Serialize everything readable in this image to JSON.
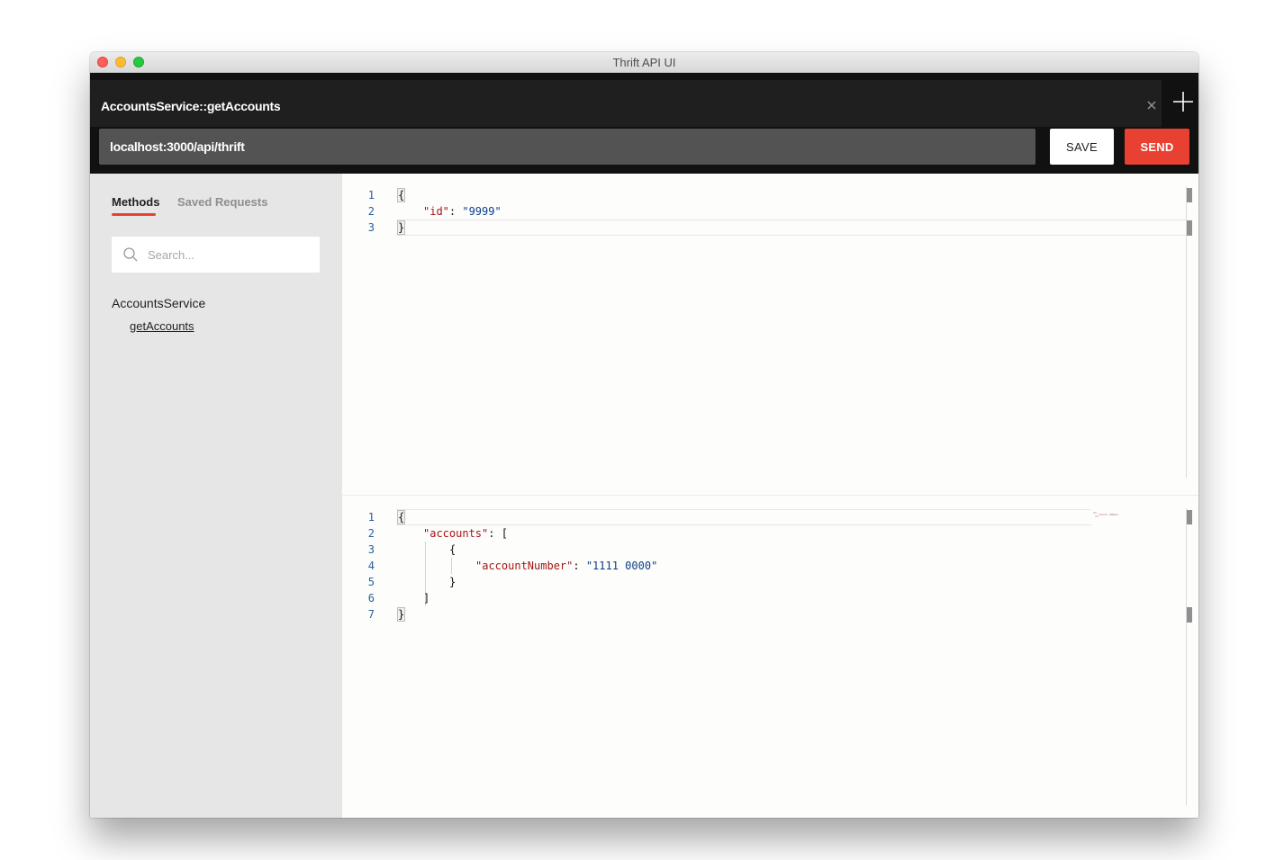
{
  "window": {
    "title": "Thrift API UI"
  },
  "tab": {
    "label": "AccountsService::getAccounts"
  },
  "request": {
    "url": "localhost:3000/api/thrift",
    "save_label": "SAVE",
    "send_label": "SEND"
  },
  "sidebar": {
    "tabs": [
      {
        "label": "Methods"
      },
      {
        "label": "Saved Requests"
      }
    ],
    "search_placeholder": "Search...",
    "service": "AccountsService",
    "methods": [
      "getAccounts"
    ]
  },
  "request_editor": {
    "line_numbers": [
      "1",
      "2",
      "3"
    ],
    "lines": {
      "l1": "{",
      "l2_key": "\"id\"",
      "l2_sep": ": ",
      "l2_val": "\"9999\"",
      "l3": "}"
    }
  },
  "response_editor": {
    "line_numbers": [
      "1",
      "2",
      "3",
      "4",
      "5",
      "6",
      "7"
    ],
    "lines": {
      "l1": "{",
      "l2_key": "\"accounts\"",
      "l2_rest": ": [",
      "l3": "{",
      "l4_key": "\"accountNumber\"",
      "l4_sep": ": ",
      "l4_val": "\"1111 0000\"",
      "l5": "}",
      "l6": "]",
      "l7": "}"
    }
  },
  "colors": {
    "accent": "#e84132",
    "json_key": "#a31515",
    "json_string": "#0b3f8a",
    "line_number": "#2a5f9e"
  }
}
